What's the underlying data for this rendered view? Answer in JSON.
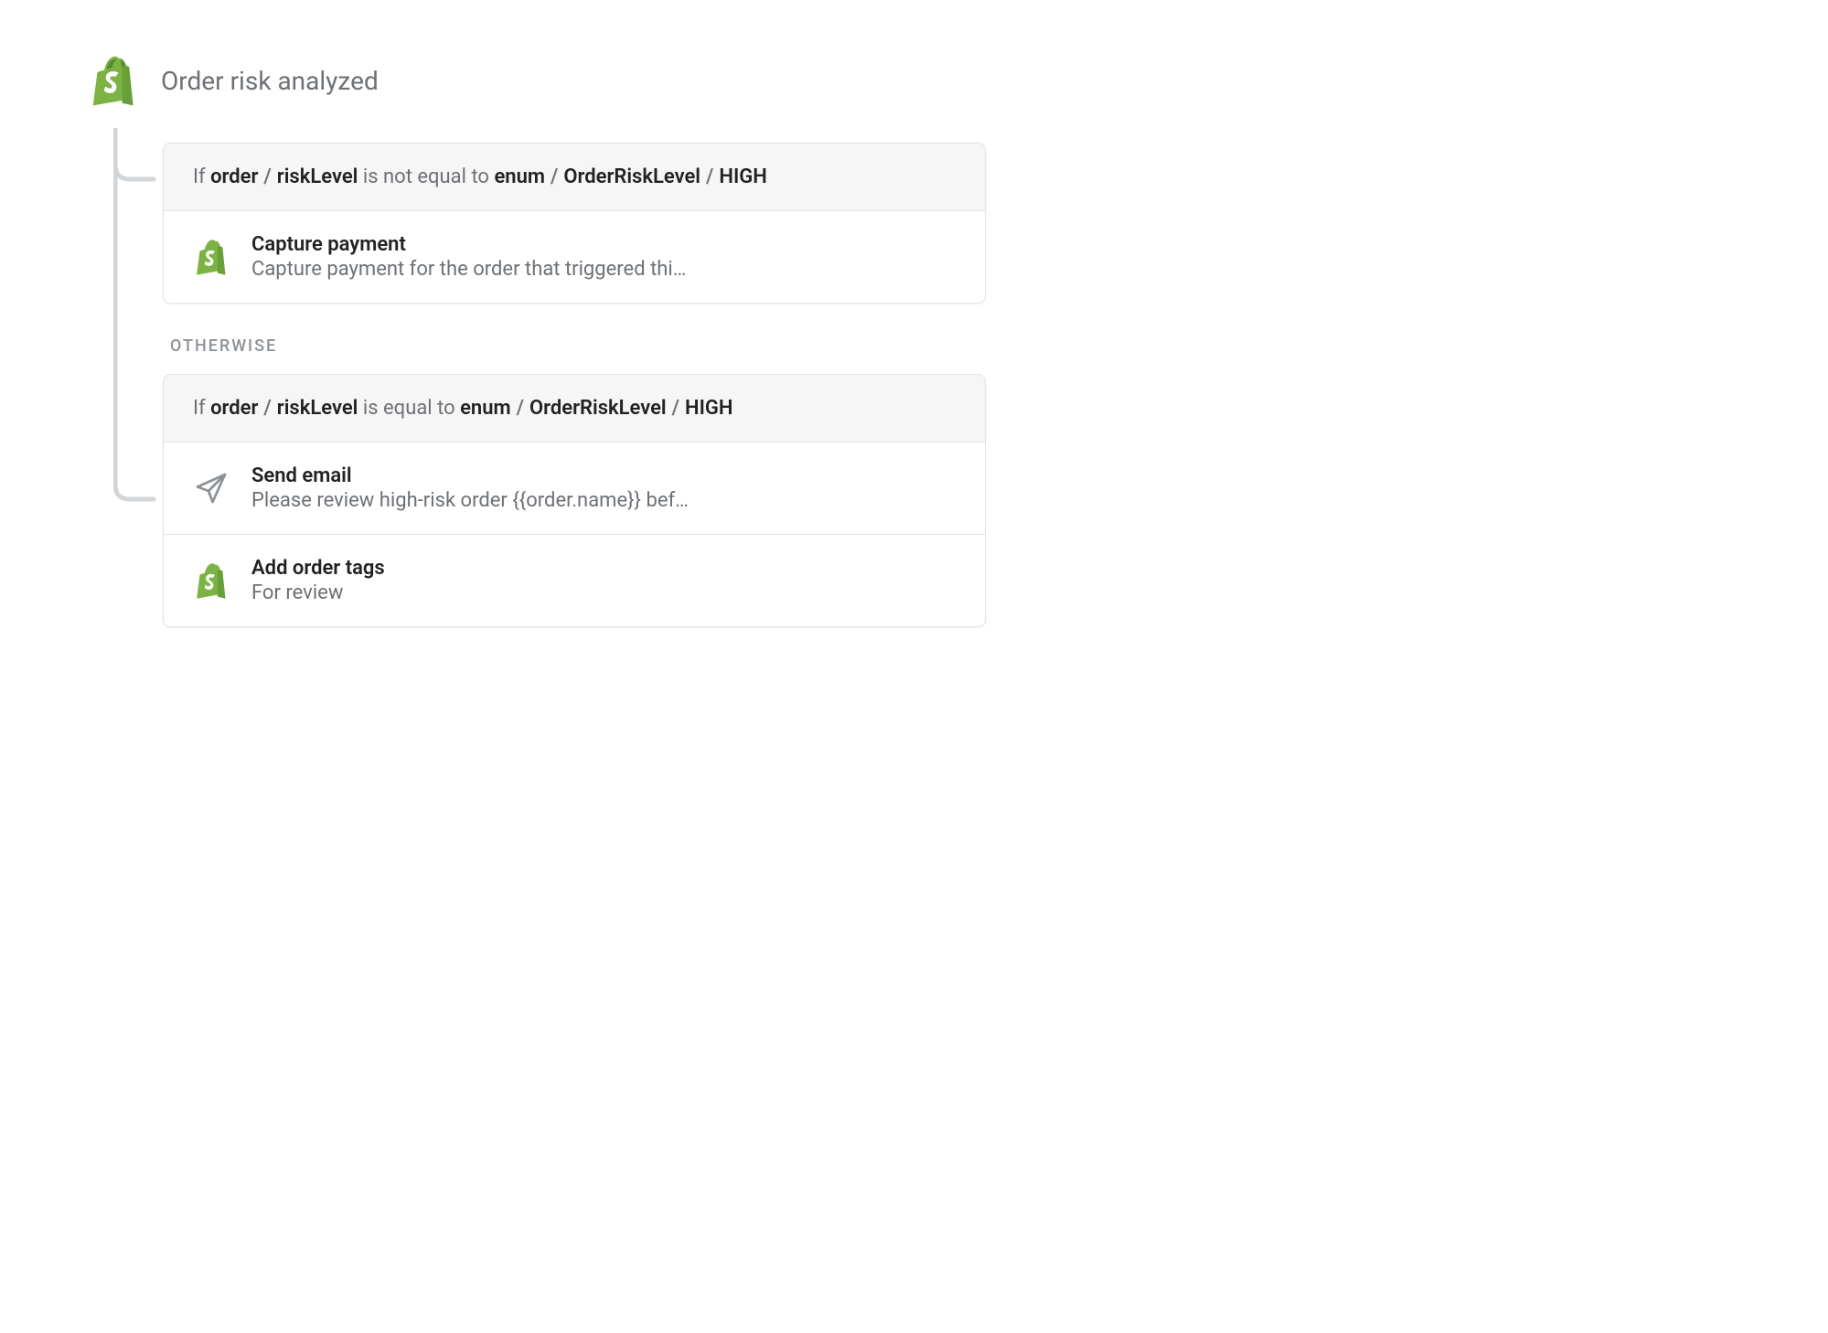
{
  "trigger": {
    "title": "Order risk analyzed"
  },
  "branch1": {
    "condition": {
      "if": "If",
      "path1": "order",
      "path2": "riskLevel",
      "op": "is not equal to",
      "enum1": "enum",
      "enum2": "OrderRiskLevel",
      "enum3": "HIGH"
    },
    "actions": [
      {
        "icon": "shopify",
        "title": "Capture payment",
        "desc": "Capture payment for the order that triggered thi…"
      }
    ]
  },
  "otherwise_label": "OTHERWISE",
  "branch2": {
    "condition": {
      "if": "If",
      "path1": "order",
      "path2": "riskLevel",
      "op": "is equal to",
      "enum1": "enum",
      "enum2": "OrderRiskLevel",
      "enum3": "HIGH"
    },
    "actions": [
      {
        "icon": "plane",
        "title": "Send email",
        "desc": "Please review high-risk order {{order.name}} bef…"
      },
      {
        "icon": "shopify",
        "title": "Add order tags",
        "desc": "For review"
      }
    ]
  }
}
